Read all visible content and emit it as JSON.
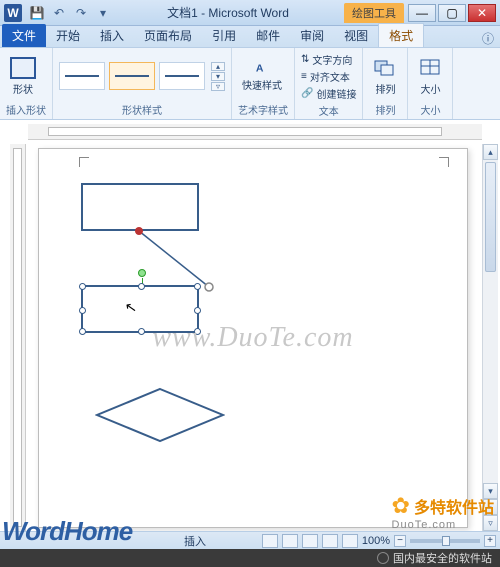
{
  "titlebar": {
    "doc_title": "文档1 - Microsoft Word",
    "context_tab": "绘图工具",
    "qat": {
      "save": "💾",
      "undo": "↶",
      "redo": "↷",
      "more": "▾"
    },
    "win": {
      "min": "—",
      "max": "▢",
      "close": "✕"
    }
  },
  "tabs": {
    "file": "文件",
    "items": [
      "开始",
      "插入",
      "页面布局",
      "引用",
      "邮件",
      "审阅",
      "视图"
    ],
    "context": "格式",
    "help": "ⓘ"
  },
  "ribbon": {
    "group_insert": {
      "label": "插入形状",
      "shape_btn": "形状"
    },
    "group_styles": {
      "label": "形状样式",
      "nav_up": "▴",
      "nav_dn": "▾",
      "nav_more": "▿"
    },
    "group_quick": {
      "btn": "快速样式",
      "label": "艺术字样式"
    },
    "group_text": {
      "label": "文本",
      "items": [
        "文字方向",
        "对齐文本",
        "创建链接"
      ],
      "icons": [
        "⇅",
        "≡",
        "🔗"
      ]
    },
    "group_arrange": {
      "label": "排列",
      "btn": "排列"
    },
    "group_size": {
      "label": "大小",
      "btn": "大小"
    }
  },
  "canvas": {
    "watermark": "www.DuoTe.com"
  },
  "statusbar": {
    "left": "插入",
    "zoom": "100%",
    "zoom_minus": "−",
    "zoom_plus": "+"
  },
  "branding": {
    "wordhome": "WordHome",
    "duote_cn": "多特软件站",
    "duote_en": "DuoTe.com",
    "footer": "国内最安全的软件站"
  }
}
